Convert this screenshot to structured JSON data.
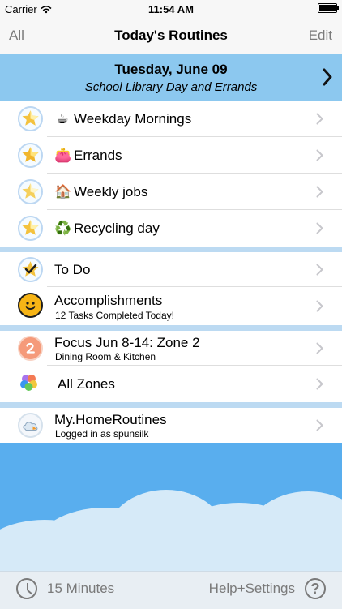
{
  "status_bar": {
    "carrier": "Carrier",
    "time": "11:54 AM"
  },
  "nav": {
    "left": "All",
    "title": "Today's Routines",
    "right": "Edit"
  },
  "date_banner": {
    "title": "Tuesday, June 09",
    "subtitle": "School Library Day and Errands"
  },
  "routines": [
    {
      "emoji": "☕",
      "label": "Weekday Mornings"
    },
    {
      "emoji": "👛",
      "label": "Errands"
    },
    {
      "emoji": "🏠",
      "label": "Weekly jobs"
    },
    {
      "emoji": "♻️",
      "label": "Recycling day"
    }
  ],
  "middle_section": [
    {
      "label": "To Do"
    },
    {
      "label": "Accomplishments",
      "sub": "12 Tasks Completed Today!"
    }
  ],
  "zones_section": [
    {
      "label": "Focus Jun 8-14: Zone 2",
      "sub": "Dining Room & Kitchen"
    },
    {
      "label": "All Zones"
    }
  ],
  "account": {
    "label": "My.HomeRoutines",
    "sub": "Logged in as spunsilk"
  },
  "toolbar": {
    "left": "15 Minutes",
    "right": "Help+Settings"
  },
  "colors": {
    "banner": "#8cc8ef",
    "separator": "#bcdaf2",
    "sky": "#59aeee",
    "cloud": "#d6eaf8",
    "toolbar_text": "#7a7a7a"
  }
}
